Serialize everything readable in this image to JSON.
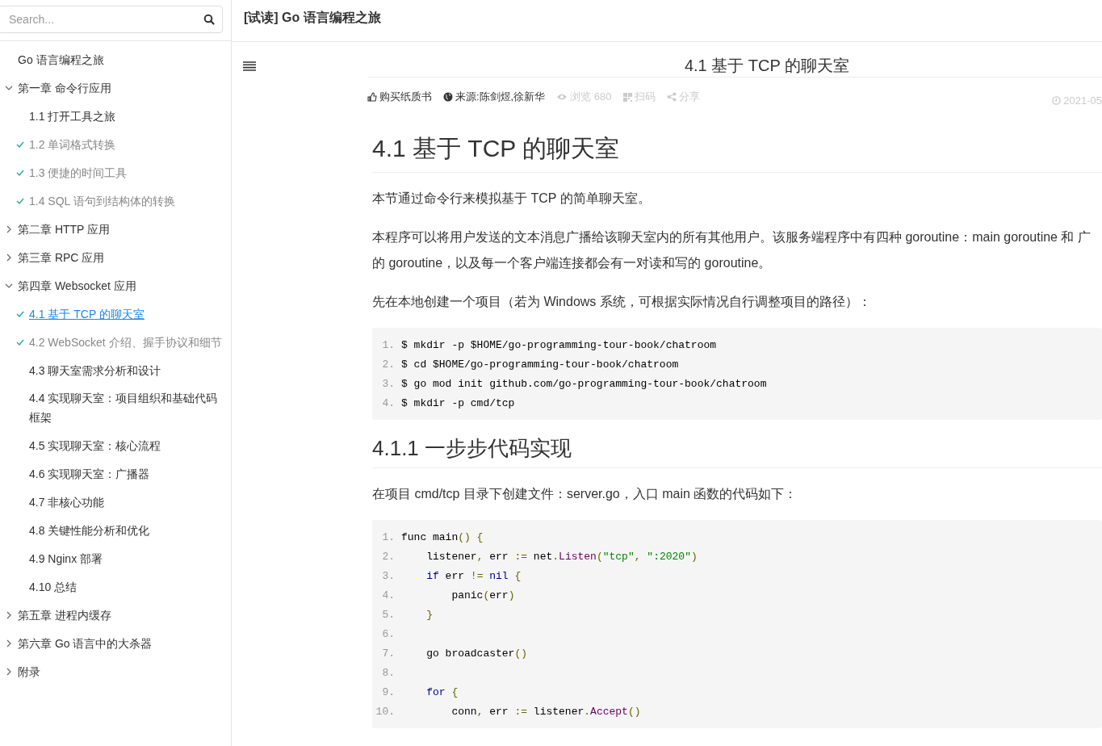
{
  "sidebar": {
    "search": {
      "placeholder": "Search..."
    },
    "items": [
      {
        "label": "Go 语言编程之旅",
        "selected": false
      },
      {
        "label": "第一章 命令行应用",
        "selected": false,
        "expanded": true,
        "children": [
          {
            "label": "1.1 打开工具之旅",
            "done": false,
            "selected": false
          },
          {
            "label": "1.2 单词格式转换",
            "done": true,
            "selected": false
          },
          {
            "label": "1.3 便捷的时间工具",
            "done": true,
            "selected": false
          },
          {
            "label": "1.4 SQL 语句到结构体的转换",
            "done": true,
            "selected": false
          }
        ]
      },
      {
        "label": "第二章 HTTP 应用",
        "selected": false,
        "expanded": false
      },
      {
        "label": "第三章 RPC 应用",
        "selected": false,
        "expanded": false
      },
      {
        "label": "第四章 Websocket 应用",
        "selected": false,
        "expanded": true,
        "children": [
          {
            "label": "4.1 基于 TCP 的聊天室",
            "done": true,
            "selected": true
          },
          {
            "label": "4.2 WebSocket 介绍、握手协议和细节",
            "done": true,
            "selected": false
          },
          {
            "label": "4.3 聊天室需求分析和设计",
            "done": false,
            "selected": false
          },
          {
            "label": "4.4 实现聊天室：项目组织和基础代码框架",
            "done": false,
            "selected": false
          },
          {
            "label": "4.5 实现聊天室：核心流程",
            "done": false,
            "selected": false
          },
          {
            "label": "4.6 实现聊天室：广播器",
            "done": false,
            "selected": false
          },
          {
            "label": "4.7 非核心功能",
            "done": false,
            "selected": false
          },
          {
            "label": "4.8 关键性能分析和优化",
            "done": false,
            "selected": false
          },
          {
            "label": "4.9 Nginx 部署",
            "done": false,
            "selected": false
          },
          {
            "label": "4.10 总结",
            "done": false,
            "selected": false
          }
        ]
      },
      {
        "label": "第五章 进程内缓存",
        "selected": false,
        "expanded": false
      },
      {
        "label": "第六章 Go 语言中的大杀器",
        "selected": false,
        "expanded": false
      },
      {
        "label": "附录",
        "selected": false,
        "expanded": false
      }
    ]
  },
  "header": {
    "title": "[试读] Go 语言编程之旅"
  },
  "article": {
    "page_title": "4.1 基于 TCP 的聊天室",
    "meta": [
      {
        "kind": "thumb",
        "text": "购买纸质书",
        "muted": false
      },
      {
        "kind": "globe",
        "text": "来源:陈剑煜,徐新华",
        "muted": false
      },
      {
        "kind": "eye",
        "text": "浏览 680",
        "muted": true
      },
      {
        "kind": "qrcode",
        "text": "扫码",
        "muted": true
      },
      {
        "kind": "share",
        "text": "分享",
        "muted": true
      }
    ],
    "date": "2021-05",
    "blocks": [
      {
        "kind": "h1",
        "text": "4.1 基于 TCP 的聊天室"
      },
      {
        "kind": "p",
        "text": "本节通过命令行来模拟基于 TCP 的简单聊天室。"
      },
      {
        "kind": "p",
        "text": "本程序可以将用户发送的文本消息广播给该聊天室内的所有其他用户。该服务端程序中有四种 goroutine：main goroutine 和 广的 goroutine，以及每一个客户端连接都会有一对读和写的 goroutine。"
      },
      {
        "kind": "p",
        "text": "先在本地创建一个项目（若为 Windows 系统，可根据实际情况自行调整项目的路径）："
      },
      {
        "kind": "code",
        "lines": [
          {
            "number": "1.",
            "tokens": [
              {
                "kind": "plain",
                "text": "$ mkdir -p $HOME/go-programming-tour-book/chatroom"
              }
            ]
          },
          {
            "number": "2.",
            "tokens": [
              {
                "kind": "plain",
                "text": "$ cd $HOME/go-programming-tour-book/chatroom"
              }
            ]
          },
          {
            "number": "3.",
            "tokens": [
              {
                "kind": "plain",
                "text": "$ go mod init github.com/go-programming-tour-book/chatroom"
              }
            ]
          },
          {
            "number": "4.",
            "tokens": [
              {
                "kind": "plain",
                "text": "$ mkdir -p cmd/tcp"
              }
            ]
          }
        ]
      },
      {
        "kind": "h2",
        "text": "4.1.1 一步步代码实现"
      },
      {
        "kind": "p",
        "text": "在项目 cmd/tcp 目录下创建文件：server.go，入口 main 函数的代码如下："
      },
      {
        "kind": "code",
        "lines": [
          {
            "number": "1.",
            "tokens": [
              {
                "kind": "plain",
                "text": "func main"
              },
              {
                "kind": "punct",
                "text": "() {"
              }
            ]
          },
          {
            "number": "2.",
            "tokens": [
              {
                "kind": "plain",
                "text": "    listener"
              },
              {
                "kind": "punct",
                "text": ","
              },
              {
                "kind": "plain",
                "text": " err "
              },
              {
                "kind": "punct",
                "text": ":="
              },
              {
                "kind": "plain",
                "text": " net"
              },
              {
                "kind": "punct",
                "text": "."
              },
              {
                "kind": "func",
                "text": "Listen"
              },
              {
                "kind": "punct",
                "text": "("
              },
              {
                "kind": "string",
                "text": "\"tcp\""
              },
              {
                "kind": "punct",
                "text": ", "
              },
              {
                "kind": "string",
                "text": "\":2020\""
              },
              {
                "kind": "punct",
                "text": ")"
              }
            ]
          },
          {
            "number": "3.",
            "tokens": [
              {
                "kind": "keyword",
                "text": "    if"
              },
              {
                "kind": "plain",
                "text": " err "
              },
              {
                "kind": "punct",
                "text": "!="
              },
              {
                "kind": "keyword",
                "text": " nil"
              },
              {
                "kind": "punct",
                "text": " {"
              }
            ]
          },
          {
            "number": "4.",
            "tokens": [
              {
                "kind": "plain",
                "text": "        panic"
              },
              {
                "kind": "punct",
                "text": "("
              },
              {
                "kind": "plain",
                "text": "err"
              },
              {
                "kind": "punct",
                "text": ")"
              }
            ]
          },
          {
            "number": "5.",
            "tokens": [
              {
                "kind": "punct",
                "text": "    }"
              }
            ]
          },
          {
            "number": "6."
          },
          {
            "number": "7.",
            "tokens": [
              {
                "kind": "plain",
                "text": "    go broadcaster"
              },
              {
                "kind": "punct",
                "text": "()"
              }
            ]
          },
          {
            "number": "8."
          },
          {
            "number": "9.",
            "tokens": [
              {
                "kind": "keyword",
                "text": "    for"
              },
              {
                "kind": "punct",
                "text": " {"
              }
            ]
          },
          {
            "number": "10.",
            "tokens": [
              {
                "kind": "plain",
                "text": "        conn"
              },
              {
                "kind": "punct",
                "text": ","
              },
              {
                "kind": "plain",
                "text": " err "
              },
              {
                "kind": "punct",
                "text": ":="
              },
              {
                "kind": "plain",
                "text": " listener"
              },
              {
                "kind": "punct",
                "text": "."
              },
              {
                "kind": "func",
                "text": "Accept"
              },
              {
                "kind": "punct",
                "text": "()"
              }
            ]
          }
        ]
      }
    ]
  }
}
